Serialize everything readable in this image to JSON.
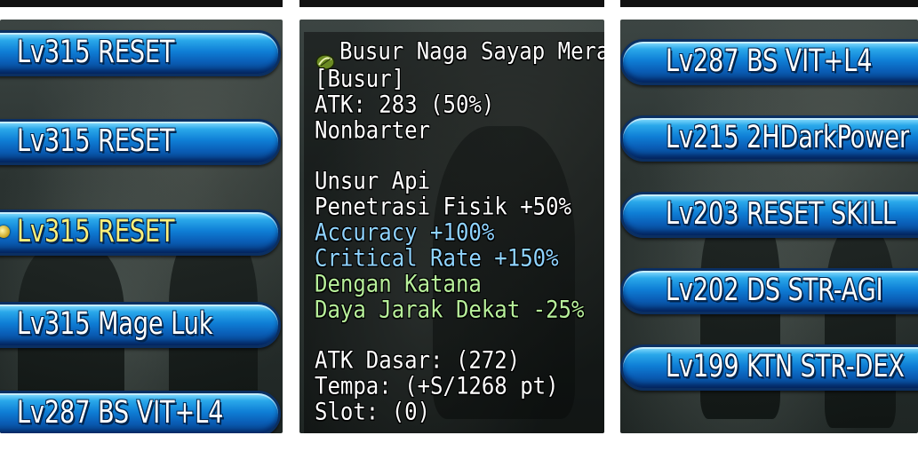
{
  "left_list": {
    "items": [
      {
        "label": "Lv315  RESET"
      },
      {
        "label": "Lv315  RESET"
      },
      {
        "label": "Lv315  RESET",
        "selected": true
      },
      {
        "label": "Lv315  Mage Luk"
      },
      {
        "label": "Lv287  BS VIT+L4"
      }
    ]
  },
  "tooltip": {
    "title": "Busur Naga Sayap Merah",
    "category": "[Busur]",
    "atk": "ATK: 283 (50%)",
    "trade": "Nonbarter",
    "element": "Unsur Api",
    "stat_phys_pen": "Penetrasi Fisik +50%",
    "stat_accuracy": "Accuracy +100%",
    "stat_crit": "Critical Rate +150%",
    "cond_katana": "Dengan Katana",
    "cond_melee": "Daya Jarak Dekat -25%",
    "base_atk": "ATK Dasar: (272)",
    "refine": "Tempa: (+S/1268 pt)",
    "slot": "Slot: (0)",
    "colors": {
      "white": "#ffffff",
      "blue": "#8fd3ff",
      "green": "#b7ef9a"
    }
  },
  "right_list": {
    "items": [
      {
        "label": "Lv287  BS VIT+L4"
      },
      {
        "label": "Lv215  2HDarkPower"
      },
      {
        "label": "Lv203  RESET SKILL"
      },
      {
        "label": "Lv202  DS STR-AGI"
      },
      {
        "label": "Lv199  KTN STR-DEX"
      }
    ]
  },
  "colors": {
    "bar_blue": "#0f7fd6",
    "selected_text": "#fff07a"
  }
}
